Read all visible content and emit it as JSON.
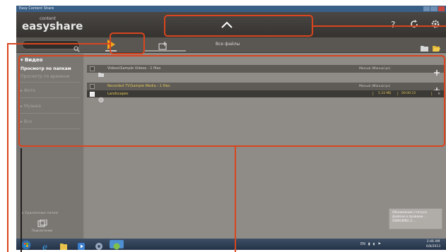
{
  "window": {
    "title": "Easy Content Share",
    "colors": {
      "header": "#3d3a36",
      "content": "#8f8c88",
      "accent_yellow": "#e0c456",
      "annotation": "#d9451e"
    }
  },
  "header": {
    "logo_small": "content",
    "logo_big": "easyshare",
    "icons": [
      "chevron-up-icon",
      "help-icon",
      "refresh-icon",
      "settings-icon"
    ]
  },
  "toolbar": {
    "search_placeholder": "",
    "tabs": [
      {
        "name": "play-tab",
        "icon": "play-icon"
      },
      {
        "name": "import-tab",
        "icon": "add-icon"
      }
    ],
    "all_files_label": "Все файлы"
  },
  "sidebar": {
    "video_label": "Видео",
    "subheading": "Просмотр по папкам",
    "items": [
      "Просмотр по времени",
      "Фото",
      "Музыка",
      "Все"
    ],
    "bottom_item": "Удаленные папки",
    "bottom_icon_label": "Подключение"
  },
  "content": {
    "rows": [
      {
        "kind": "folder",
        "name": "Videos\\Sample Videos - 1 files",
        "status": "Manual (Manual pc)"
      },
      {
        "kind": "folder",
        "name": "Recorded TV\\Sample Media - 1 files",
        "status": "Manual (Manual pc)"
      }
    ],
    "file": {
      "name": "Landscapes",
      "size": "5.33 МБ",
      "duration": "00:00:15"
    }
  },
  "notification": {
    "text": "Обновление статуса файлов в правами ... SWBGMB2.3 ..."
  },
  "taskbar": {
    "tray_lang": "EN",
    "clock_time": "2:46 AM",
    "clock_date": "6/8/2013"
  }
}
